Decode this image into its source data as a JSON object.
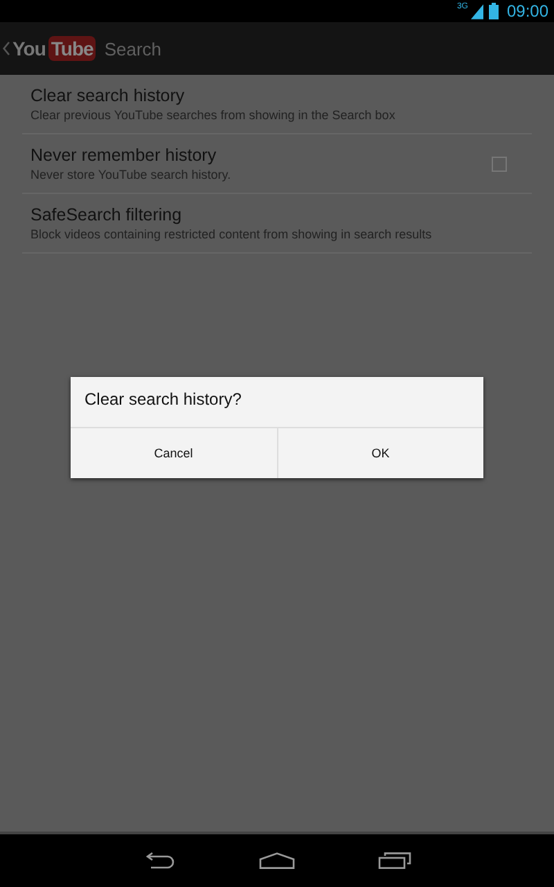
{
  "status_bar": {
    "network": "3G",
    "time": "09:00"
  },
  "action_bar": {
    "logo_left": "You",
    "logo_right": "Tube",
    "title": "Search"
  },
  "settings": [
    {
      "kind": "plain",
      "title": "Clear search history",
      "summary": "Clear previous YouTube searches from showing in the Search box"
    },
    {
      "kind": "checkbox",
      "title": "Never remember history",
      "summary": "Never store YouTube search history.",
      "checked": false
    },
    {
      "kind": "plain",
      "title": "SafeSearch filtering",
      "summary": "Block videos containing restricted content from showing in search results"
    }
  ],
  "dialog": {
    "message": "Clear search history?",
    "buttons": [
      "Cancel",
      "OK"
    ]
  }
}
